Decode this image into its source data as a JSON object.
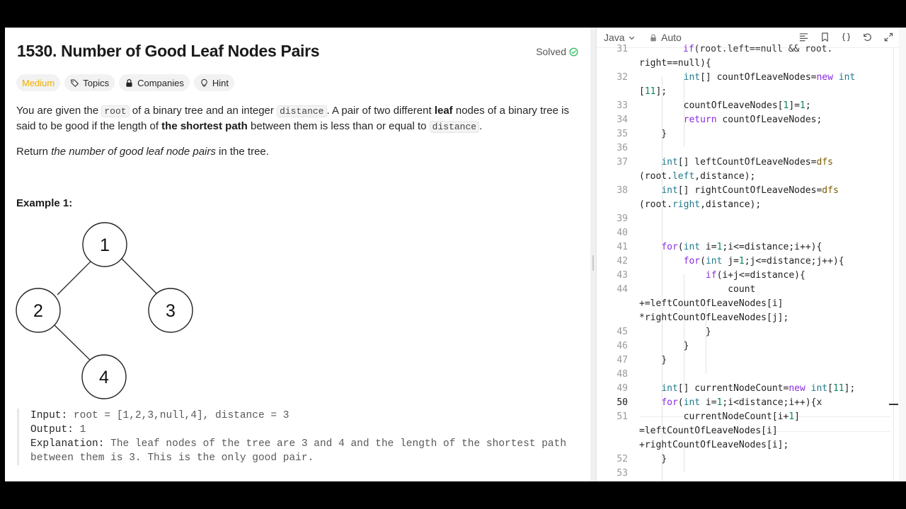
{
  "problem": {
    "title": "1530. Number of Good Leaf Nodes Pairs",
    "solved_label": "Solved",
    "tags": [
      "Medium",
      "Topics",
      "Companies",
      "Hint"
    ],
    "desc1_a": "You are given the ",
    "desc1_code1": "root",
    "desc1_b": " of a binary tree and an integer ",
    "desc1_code2": "distance",
    "desc1_c": ". A pair of two different ",
    "desc1_bold1": "leaf",
    "desc1_d": " nodes of a binary tree is said to be good if the length of ",
    "desc1_bold2": "the shortest path",
    "desc1_e": " between them is less than or equal to ",
    "desc1_code3": "distance",
    "desc1_f": ".",
    "desc2_a": "Return ",
    "desc2_italic": "the number of good leaf node pairs",
    "desc2_b": " in the tree.",
    "example_heading": "Example 1:",
    "tree_nodes": [
      "1",
      "2",
      "3",
      "4"
    ],
    "input_label": "Input:",
    "input_value": " root = [1,2,3,null,4], distance = 3",
    "output_label": "Output:",
    "output_value": " 1",
    "explanation_label": "Explanation:",
    "explanation_line1": " The leaf nodes of the tree are 3 and 4 and the length of the shortest path",
    "explanation_line2": "between them is 3. This is the only good pair."
  },
  "editor": {
    "language": "Java",
    "mode": "Auto",
    "line_numbers": [
      "31",
      "32",
      "33",
      "34",
      "35",
      "36",
      "37",
      "38",
      "39",
      "40",
      "41",
      "42",
      "43",
      "44",
      "45",
      "46",
      "47",
      "48",
      "49",
      "50",
      "51",
      "52",
      "53"
    ],
    "active_line": "50"
  },
  "colors": {
    "medium": "#f0b000",
    "solved_check": "#2cbb5d",
    "keyword": "#8a2be2",
    "type": "#1f7a8c"
  }
}
